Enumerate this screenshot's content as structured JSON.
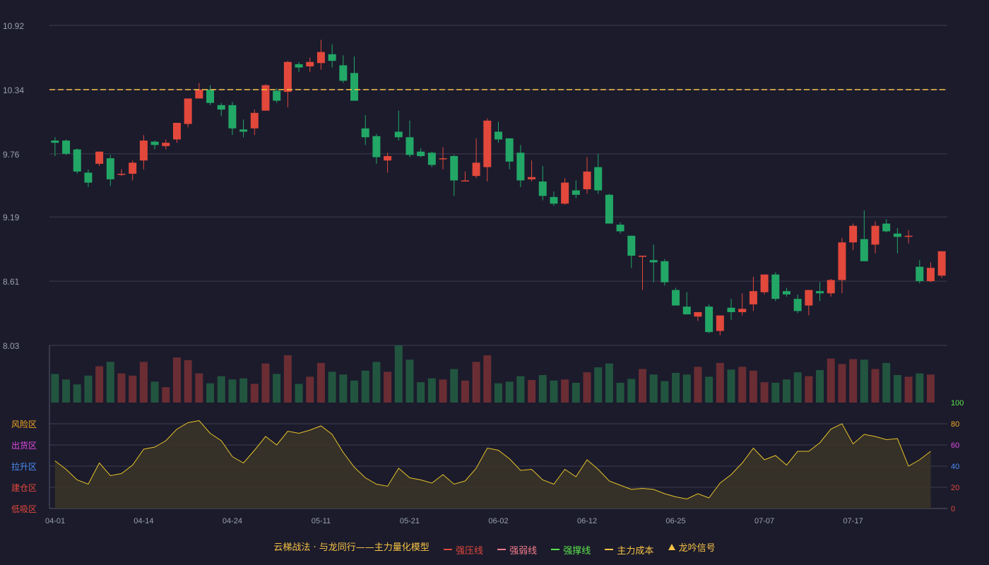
{
  "chart_data": {
    "type": "candlestick",
    "price_axis": {
      "ticks": [
        8.03,
        8.61,
        9.19,
        9.76,
        10.34,
        10.92
      ],
      "range": [
        8.03,
        10.92
      ]
    },
    "main_cost_line": 10.34,
    "x_ticks": [
      "04-01",
      "04-14",
      "04-24",
      "05-11",
      "05-21",
      "06-02",
      "06-12",
      "06-25",
      "07-07",
      "07-17"
    ],
    "candles": [
      [
        9.88,
        9.91,
        9.74,
        9.86
      ],
      [
        9.88,
        9.89,
        9.75,
        9.76
      ],
      [
        9.8,
        9.81,
        9.58,
        9.6
      ],
      [
        9.59,
        9.62,
        9.46,
        9.5
      ],
      [
        9.67,
        9.78,
        9.65,
        9.78
      ],
      [
        9.72,
        9.75,
        9.47,
        9.53
      ],
      [
        9.58,
        9.62,
        9.56,
        9.58
      ],
      [
        9.58,
        9.7,
        9.52,
        9.68
      ],
      [
        9.7,
        9.93,
        9.62,
        9.88
      ],
      [
        9.87,
        9.88,
        9.8,
        9.84
      ],
      [
        9.83,
        9.89,
        9.8,
        9.86
      ],
      [
        9.89,
        10.0,
        9.86,
        10.04
      ],
      [
        10.03,
        10.26,
        10.0,
        10.26
      ],
      [
        10.26,
        10.4,
        10.26,
        10.34
      ],
      [
        10.34,
        10.38,
        10.2,
        10.22
      ],
      [
        10.2,
        10.22,
        10.1,
        10.16
      ],
      [
        10.2,
        10.23,
        9.93,
        9.99
      ],
      [
        9.98,
        10.07,
        9.91,
        9.96
      ],
      [
        9.99,
        10.16,
        9.93,
        10.13
      ],
      [
        10.15,
        10.39,
        10.15,
        10.38
      ],
      [
        10.33,
        10.35,
        10.22,
        10.24
      ],
      [
        10.32,
        10.6,
        10.18,
        10.59
      ],
      [
        10.57,
        10.59,
        10.5,
        10.54
      ],
      [
        10.55,
        10.63,
        10.5,
        10.59
      ],
      [
        10.58,
        10.79,
        10.52,
        10.68
      ],
      [
        10.66,
        10.75,
        10.54,
        10.6
      ],
      [
        10.56,
        10.65,
        10.4,
        10.42
      ],
      [
        10.49,
        10.64,
        10.28,
        10.24
      ],
      [
        9.99,
        10.11,
        9.84,
        9.91
      ],
      [
        9.92,
        9.94,
        9.67,
        9.73
      ],
      [
        9.7,
        9.77,
        9.59,
        9.74
      ],
      [
        9.96,
        10.15,
        9.88,
        9.91
      ],
      [
        9.91,
        10.06,
        9.73,
        9.75
      ],
      [
        9.78,
        9.81,
        9.73,
        9.74
      ],
      [
        9.77,
        9.78,
        9.64,
        9.66
      ],
      [
        9.72,
        9.82,
        9.62,
        9.72
      ],
      [
        9.74,
        9.75,
        9.38,
        9.52
      ],
      [
        9.52,
        9.6,
        9.54,
        9.52
      ],
      [
        9.56,
        9.9,
        9.54,
        9.68
      ],
      [
        9.64,
        10.08,
        9.51,
        10.06
      ],
      [
        9.96,
        10.05,
        9.86,
        9.89
      ],
      [
        9.9,
        9.87,
        9.62,
        9.69
      ],
      [
        9.77,
        9.84,
        9.46,
        9.52
      ],
      [
        9.53,
        9.7,
        9.51,
        9.55
      ],
      [
        9.51,
        9.65,
        9.34,
        9.38
      ],
      [
        9.37,
        9.42,
        9.29,
        9.31
      ],
      [
        9.31,
        9.54,
        9.3,
        9.5
      ],
      [
        9.43,
        9.52,
        9.36,
        9.39
      ],
      [
        9.44,
        9.73,
        9.4,
        9.6
      ],
      [
        9.64,
        9.76,
        9.4,
        9.43
      ],
      [
        9.39,
        9.4,
        9.17,
        9.13
      ],
      [
        9.12,
        9.14,
        9.04,
        9.06
      ],
      [
        9.02,
        9.0,
        8.73,
        8.84
      ],
      [
        8.83,
        8.82,
        8.53,
        8.84
      ],
      [
        8.8,
        8.94,
        8.6,
        8.78
      ],
      [
        8.79,
        8.81,
        8.57,
        8.6
      ],
      [
        8.53,
        8.55,
        8.43,
        8.39
      ],
      [
        8.38,
        8.51,
        8.32,
        8.31
      ],
      [
        8.29,
        8.32,
        8.25,
        8.33
      ],
      [
        8.38,
        8.4,
        8.14,
        8.15
      ],
      [
        8.16,
        8.24,
        8.12,
        8.3
      ],
      [
        8.37,
        8.45,
        8.26,
        8.33
      ],
      [
        8.33,
        8.5,
        8.3,
        8.36
      ],
      [
        8.4,
        8.65,
        8.34,
        8.52
      ],
      [
        8.51,
        8.66,
        8.49,
        8.67
      ],
      [
        8.67,
        8.69,
        8.43,
        8.45
      ],
      [
        8.52,
        8.55,
        8.47,
        8.49
      ],
      [
        8.45,
        8.49,
        8.32,
        8.34
      ],
      [
        8.39,
        8.52,
        8.3,
        8.53
      ],
      [
        8.52,
        8.6,
        8.43,
        8.5
      ],
      [
        8.5,
        8.63,
        8.47,
        8.62
      ],
      [
        8.62,
        9.0,
        8.5,
        8.96
      ],
      [
        8.96,
        9.13,
        8.89,
        9.11
      ],
      [
        8.99,
        9.25,
        8.97,
        8.79
      ],
      [
        8.94,
        9.15,
        8.86,
        9.11
      ],
      [
        9.13,
        9.17,
        9.05,
        9.06
      ],
      [
        9.04,
        9.09,
        8.86,
        9.01
      ],
      [
        9.02,
        9.07,
        8.95,
        9.02
      ],
      [
        8.74,
        8.8,
        8.59,
        8.61
      ],
      [
        8.61,
        8.78,
        8.6,
        8.73
      ],
      [
        8.66,
        8.84,
        8.64,
        8.88
      ]
    ],
    "volume": [
      52,
      42,
      33,
      49,
      66,
      74,
      53,
      49,
      74,
      38,
      28,
      82,
      77,
      53,
      35,
      48,
      42,
      44,
      34,
      71,
      52,
      86,
      34,
      47,
      72,
      56,
      51,
      40,
      58,
      74,
      56,
      104,
      78,
      37,
      44,
      42,
      61,
      40,
      74,
      86,
      35,
      38,
      48,
      41,
      50,
      40,
      42,
      36,
      55,
      64,
      71,
      36,
      43,
      61,
      51,
      39,
      54,
      51,
      65,
      47,
      72,
      60,
      65,
      58,
      37,
      36,
      42,
      55,
      48,
      59,
      80,
      70,
      79,
      78,
      61,
      72,
      50,
      47,
      53,
      51
    ],
    "indicator": {
      "range": [
        0,
        100
      ],
      "ticks": [
        0,
        20,
        40,
        60,
        80,
        100
      ],
      "zones": [
        "低吸区",
        "建仓区",
        "拉升区",
        "出货区",
        "风险区"
      ],
      "values": [
        45,
        37,
        27,
        23,
        43,
        31,
        33,
        41,
        56,
        58,
        64,
        75,
        81,
        83,
        71,
        64,
        49,
        43,
        55,
        68,
        60,
        73,
        71,
        74,
        78,
        70,
        53,
        39,
        29,
        23,
        21,
        38,
        29,
        27,
        24,
        32,
        23,
        26,
        38,
        57,
        55,
        47,
        36,
        37,
        27,
        23,
        37,
        30,
        46,
        37,
        26,
        22,
        18,
        19,
        18,
        14,
        11,
        9,
        14,
        10,
        24,
        32,
        43,
        57,
        46,
        50,
        41,
        54,
        54,
        62,
        75,
        80,
        61,
        70,
        68,
        65,
        66,
        40,
        46,
        54
      ]
    }
  },
  "colors": {
    "background": "#1b1b2c",
    "up": "#e2483b",
    "down": "#22a766",
    "up_volume": "#6a2d33",
    "down_volume": "#22553f",
    "cost_line": "#f6c244",
    "indicator_line": "#e6c229",
    "grid": "#3d3d50",
    "axis_text": "#9aa0ad"
  },
  "zone_colors": [
    "#e2483b",
    "#e2483b",
    "#4b8ef6",
    "#e14be0",
    "#f5a623"
  ],
  "indicator_tick_colors": [
    "#e2483b",
    "#e2483b",
    "#4b8ef6",
    "#e14be0",
    "#f5a623",
    "#5be34b"
  ],
  "legend": {
    "model": "云梯战法 · 与龙同行——主力量化模型",
    "strong_pressure": "强压线",
    "strong_weak": "强弱线",
    "strong_support": "强撑线",
    "main_cost": "主力成本",
    "signal": "龙吟信号"
  }
}
